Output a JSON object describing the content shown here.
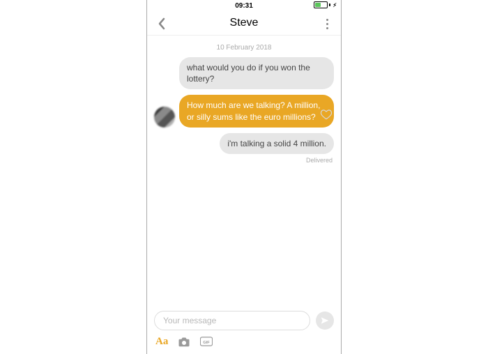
{
  "status": {
    "time": "09:31"
  },
  "header": {
    "title": "Steve"
  },
  "conversation": {
    "date": "10 February 2018",
    "messages": [
      {
        "text": "what would you do if you won the lottery?"
      },
      {
        "text": "How much are we talking? A million, or silly sums like the euro millions?"
      },
      {
        "text": "i'm talking a solid 4 million."
      }
    ],
    "status": "Delivered"
  },
  "composer": {
    "placeholder": "Your message",
    "aa_label": "Aa"
  }
}
